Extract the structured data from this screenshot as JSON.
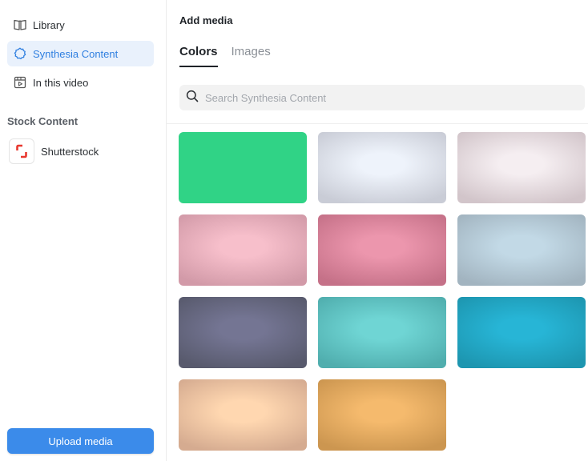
{
  "sidebar": {
    "items": [
      {
        "label": "Library",
        "icon": "book-icon"
      },
      {
        "label": "Synthesia Content",
        "icon": "gear-badge-icon",
        "active": true
      },
      {
        "label": "In this video",
        "icon": "video-frame-icon"
      }
    ],
    "stock_section_title": "Stock Content",
    "stock_items": [
      {
        "label": "Shutterstock",
        "icon": "shutterstock-logo",
        "color": "#e8382f"
      }
    ],
    "upload_label": "Upload media"
  },
  "main": {
    "title": "Add media",
    "tabs": [
      {
        "label": "Colors",
        "active": true
      },
      {
        "label": "Images",
        "active": false
      }
    ],
    "search": {
      "placeholder": "Search Synthesia Content",
      "value": ""
    },
    "swatches": [
      {
        "name": "green",
        "center": "#30d386",
        "edge": "#30d386"
      },
      {
        "name": "light-blue",
        "center": "#eef3fb",
        "edge": "#c9ccd6"
      },
      {
        "name": "light-pink",
        "center": "#f5eef1",
        "edge": "#d2c5ca"
      },
      {
        "name": "pink",
        "center": "#f7bfcb",
        "edge": "#d29aa8"
      },
      {
        "name": "rose",
        "center": "#ec96ad",
        "edge": "#c57188"
      },
      {
        "name": "steel-blue",
        "center": "#c2d9e6",
        "edge": "#a2b4c0"
      },
      {
        "name": "slate",
        "center": "#747593",
        "edge": "#585a6d"
      },
      {
        "name": "teal",
        "center": "#6fd5d4",
        "edge": "#50aeae"
      },
      {
        "name": "cyan",
        "center": "#27b5d6",
        "edge": "#1d96b0"
      },
      {
        "name": "peach",
        "center": "#ffd7b0",
        "edge": "#d5ab90"
      },
      {
        "name": "orange",
        "center": "#f5ba6d",
        "edge": "#cc9650"
      }
    ]
  },
  "colors": {
    "accent": "#3b8bea",
    "active_bg": "#e9f1fc",
    "active_text": "#2f7fe0"
  }
}
